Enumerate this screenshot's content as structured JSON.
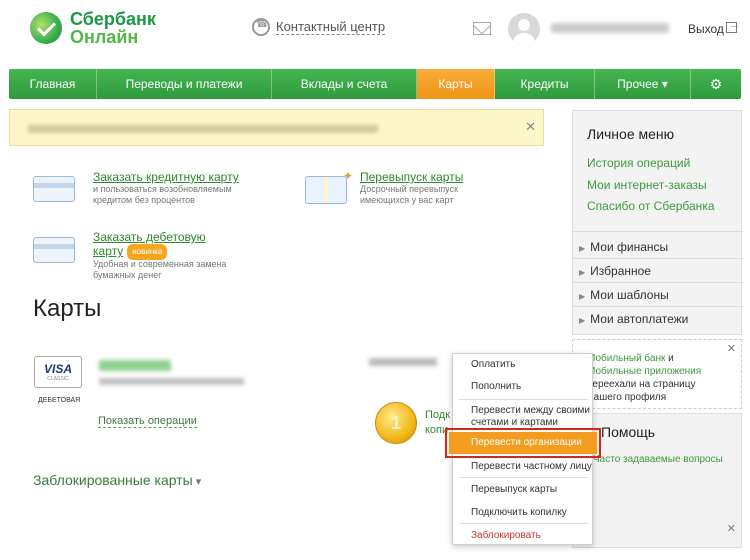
{
  "header": {
    "logo_line1": "Сбербанк",
    "logo_line2": "Онлайн",
    "contact_center": "Контактный центр",
    "exit_label": "Выход"
  },
  "nav": {
    "items": [
      {
        "label": "Главная"
      },
      {
        "label": "Переводы и платежи"
      },
      {
        "label": "Вклады и счета"
      },
      {
        "label": "Карты"
      },
      {
        "label": "Кредиты"
      },
      {
        "label": "Прочее ▾"
      }
    ],
    "active": "Карты",
    "settings_icon": "gear-icon"
  },
  "actions": {
    "credit_card_link": "Заказать кредитную карту",
    "credit_card_desc": "и пользоваться возобновляемым кредитом без процентов",
    "reissue_link": "Перевыпуск карты",
    "reissue_desc": "Досрочный перевыпуск имеющихся у вас карт",
    "debit_card_link": "Заказать дебетовую карту",
    "new_badge": "новинка",
    "debit_card_desc": "Удобная и современная замена бумажных денег"
  },
  "page_title": "Карты",
  "card": {
    "brand": "VISA",
    "brand_sub": "CLASSIC",
    "type": "ДЕБЕТОВАЯ",
    "show_operations": "Показать операции"
  },
  "promo_coin": {
    "number": "1",
    "text": "Подк копи"
  },
  "blocked_cards": "Заблокированные карты",
  "right_menu": {
    "title": "Личное меню",
    "links": [
      "История операций",
      "Мои интернет-заказы",
      "Спасибо от Сбербанка"
    ],
    "items": [
      "Мои финансы",
      "Избранное",
      "Мои шаблоны",
      "Мои автоплатежи"
    ]
  },
  "right_promo": {
    "part1": "Мобильный банк",
    "part2": " и ",
    "part3": "Мобильные приложения",
    "part4": " переехали на страницу Вашего профиля"
  },
  "help": {
    "title": "Помощь",
    "link": "Часто задаваемые вопросы"
  },
  "dropdown": {
    "items": [
      "Оплатить",
      "Пополнить",
      "Перевести между своими счетами и картами",
      "Перевести организации",
      "Перевести частному лицу",
      "Перевыпуск карты",
      "Подключить копилку",
      "Заблокировать"
    ],
    "highlighted": "Перевести организации"
  },
  "colors": {
    "brand_green": "#2f9a3f",
    "accent_orange": "#f39c1f",
    "highlight_border": "#d6261c"
  }
}
